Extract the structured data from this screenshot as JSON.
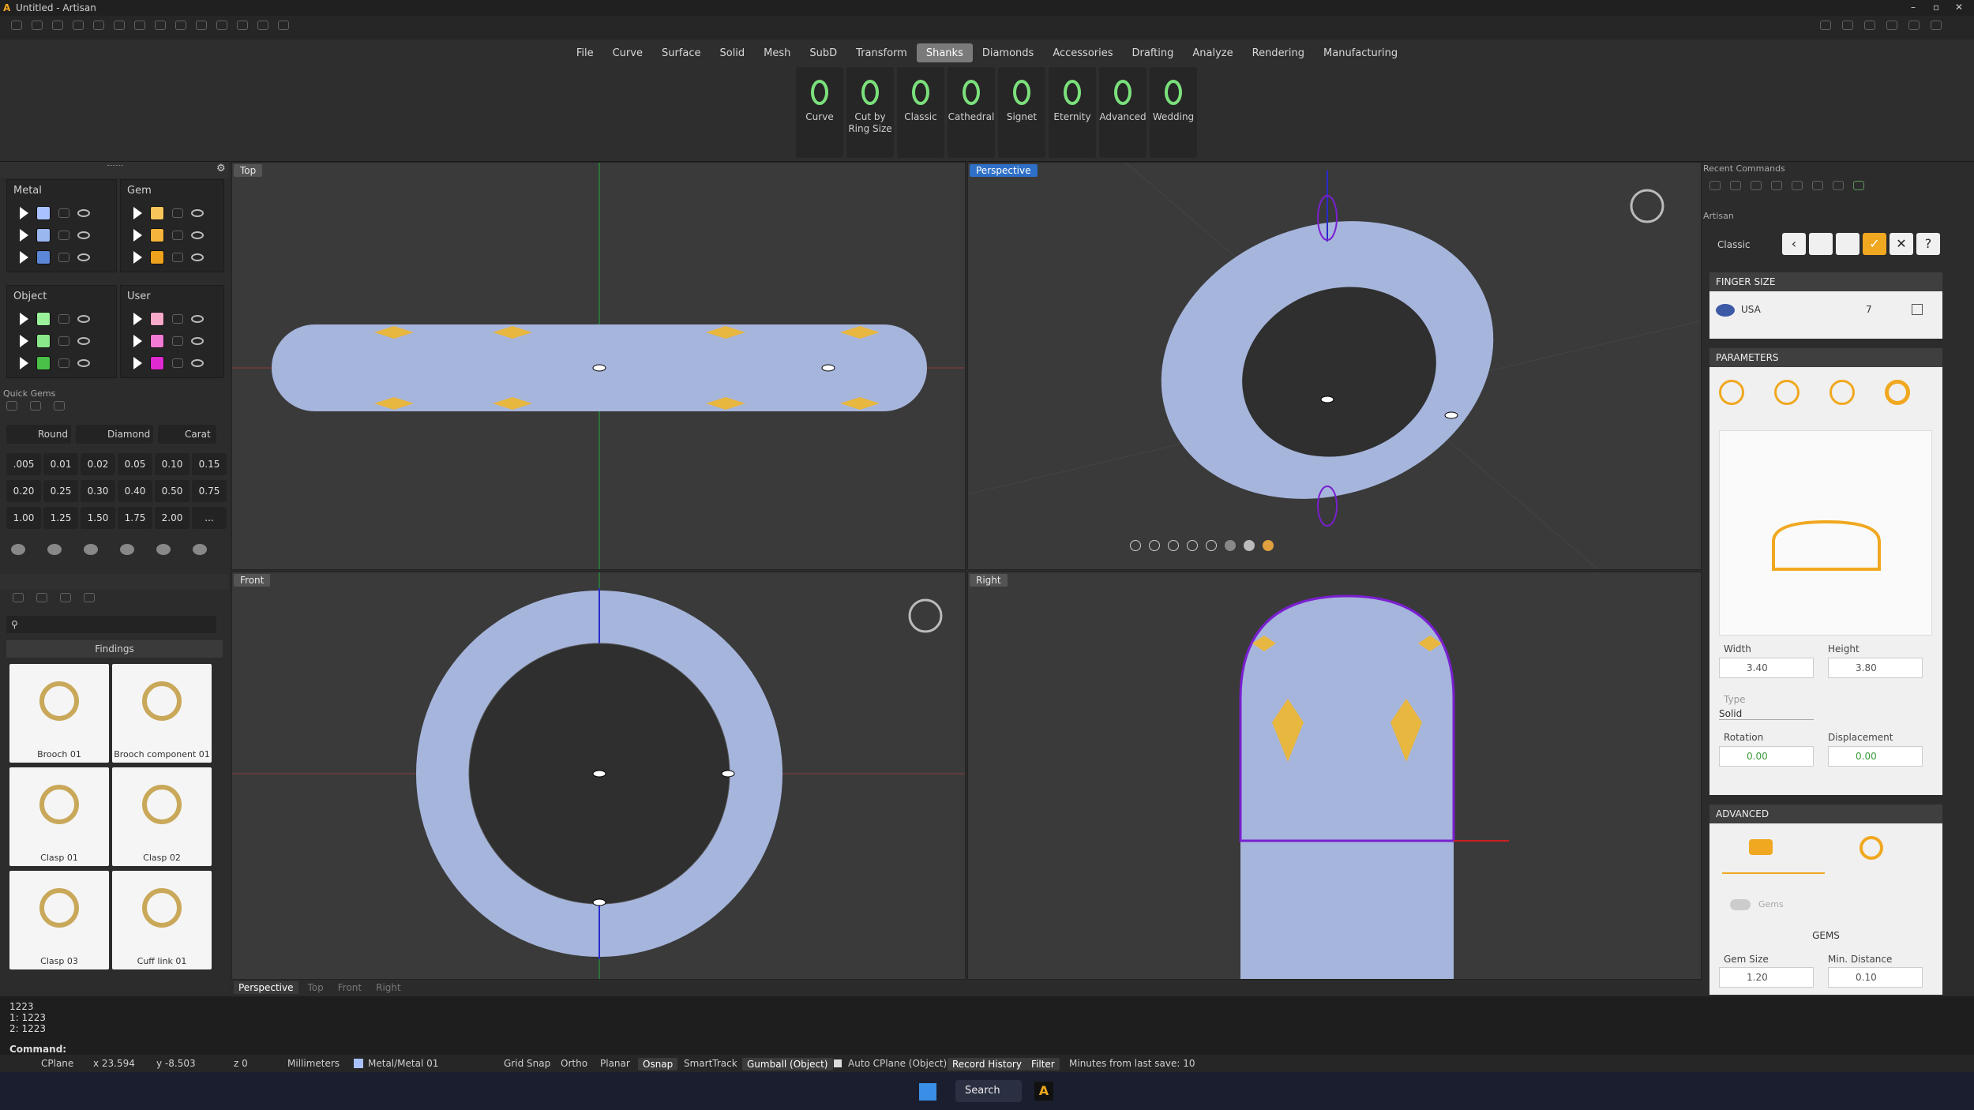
{
  "app": {
    "title": "Untitled - Artisan"
  },
  "menu": [
    "File",
    "Curve",
    "Surface",
    "Solid",
    "Mesh",
    "SubD",
    "Transform",
    "Shanks",
    "Diamonds",
    "Accessories",
    "Drafting",
    "Analyze",
    "Rendering",
    "Manufacturing"
  ],
  "menu_active": "Shanks",
  "ribbon_tools": [
    {
      "label": "Curve",
      "icon": "curve-shank-icon"
    },
    {
      "label": "Cut by Ring Size",
      "icon": "cut-ring-icon"
    },
    {
      "label": "Classic",
      "icon": "classic-ring-icon"
    },
    {
      "label": "Cathedral",
      "icon": "cathedral-ring-icon"
    },
    {
      "label": "Signet",
      "icon": "signet-ring-icon"
    },
    {
      "label": "Eternity",
      "icon": "eternity-ring-icon"
    },
    {
      "label": "Advanced",
      "icon": "advanced-ring-icon"
    },
    {
      "label": "Wedding",
      "icon": "wedding-ring-icon"
    }
  ],
  "layers": {
    "metal": {
      "title": "Metal",
      "colors": [
        "#a9c2ff",
        "#9bb7f0",
        "#5c86d6"
      ]
    },
    "gem": {
      "title": "Gem",
      "colors": [
        "#f7c55a",
        "#f5b43c",
        "#eda21d"
      ]
    },
    "object": {
      "title": "Object",
      "colors": [
        "#9af29a",
        "#8ae88a",
        "#49c149"
      ]
    },
    "user": {
      "title": "User",
      "colors": [
        "#f7a9c9",
        "#f27ad4",
        "#e02ad1"
      ]
    }
  },
  "quick_gems": {
    "title": "Quick Gems",
    "shape": "Round",
    "material": "Diamond",
    "unit": "Carat",
    "values": [
      ".005",
      "0.01",
      "0.02",
      "0.05",
      "0.10",
      "0.15",
      "0.20",
      "0.25",
      "0.30",
      "0.40",
      "0.50",
      "0.75",
      "1.00",
      "1.25",
      "1.50",
      "1.75",
      "2.00",
      "..."
    ]
  },
  "library": {
    "category": "Findings",
    "items": [
      "Brooch 01",
      "Brooch component 01",
      "Clasp 01",
      "Clasp 02",
      "Clasp 03",
      "Cuff link 01"
    ]
  },
  "viewports": {
    "top": "Top",
    "perspective": "Perspective",
    "front": "Front",
    "right": "Right"
  },
  "viewport_tabs": [
    "Perspective",
    "Top",
    "Front",
    "Right"
  ],
  "right_panel": {
    "recent_title": "Recent Commands",
    "artisan_title": "Artisan",
    "command_name": "Classic",
    "finger_size_title": "FINGER SIZE",
    "country": "USA",
    "size": "7",
    "parameters_title": "PARAMETERS",
    "width_label": "Width",
    "width": "3.40",
    "height_label": "Height",
    "height": "3.80",
    "type_label": "Type",
    "type": "Solid",
    "rotation_label": "Rotation",
    "rotation": "0.00",
    "displacement_label": "Displacement",
    "displacement": "0.00",
    "advanced_title": "ADVANCED",
    "gems_toggle": "Gems",
    "gems_heading": "GEMS",
    "gem_size_label": "Gem Size",
    "gem_size": "1.20",
    "min_distance_label": "Min. Distance",
    "min_distance": "0.10"
  },
  "command_history": [
    "1223",
    "1: 1223",
    "2: 1223"
  ],
  "command_prompt": "Command:",
  "status": {
    "cplane": "CPlane",
    "x": "x 23.594",
    "y": "y -8.503",
    "z": "z 0",
    "units": "Millimeters",
    "layer": "Metal/Metal 01",
    "grid_snap": "Grid Snap",
    "ortho": "Ortho",
    "planar": "Planar",
    "osnap": "Osnap",
    "smarttrack": "SmartTrack",
    "gumball": "Gumball (Object)",
    "auto_cplane": "Auto CPlane (Object)",
    "record_history": "Record History",
    "filter": "Filter",
    "save_info": "Minutes from last save: 10"
  },
  "taskbar": {
    "search": "Search"
  },
  "colors": {
    "accent": "#f0a820",
    "ring": "#a3b2d8",
    "gem": "#e8b740",
    "selection": "#7a1fd0"
  }
}
